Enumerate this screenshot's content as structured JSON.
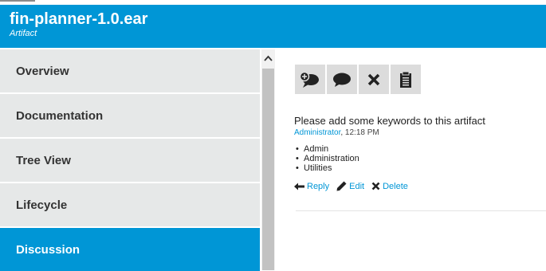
{
  "header": {
    "title": "fin-planner-1.0.ear",
    "subtitle": "Artifact",
    "color": "#0096d6"
  },
  "sidebar": {
    "items": [
      {
        "label": "Overview"
      },
      {
        "label": "Documentation"
      },
      {
        "label": "Tree View"
      },
      {
        "label": "Lifecycle"
      },
      {
        "label": "Discussion",
        "active": true
      }
    ]
  },
  "toolbar": {
    "buttons": [
      {
        "icon": "add-comment-icon"
      },
      {
        "icon": "comment-icon"
      },
      {
        "icon": "close-icon"
      },
      {
        "icon": "clipboard-icon"
      }
    ]
  },
  "comment": {
    "message": "Please add some keywords to this artifact",
    "author": "Administrator",
    "time": ", 12:18 PM",
    "keywords": [
      "Admin",
      "Administration",
      "Utilities"
    ],
    "actions": {
      "reply": "Reply",
      "edit": "Edit",
      "delete": "Delete"
    }
  }
}
